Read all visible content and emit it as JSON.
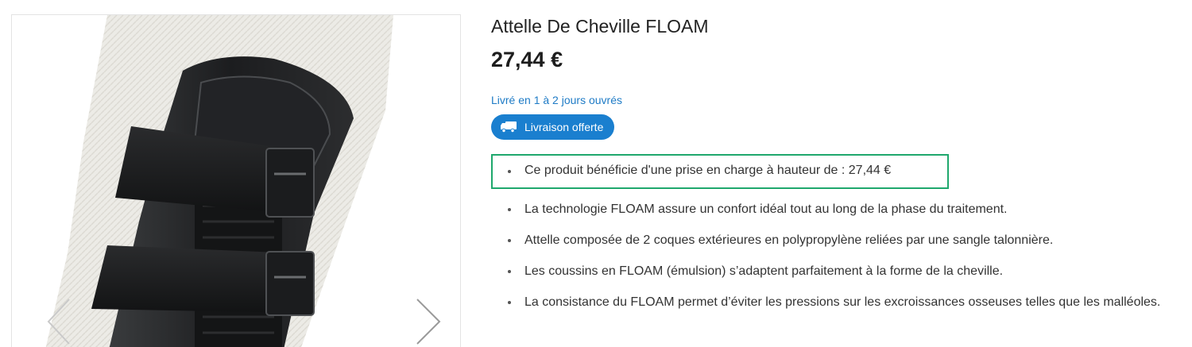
{
  "product": {
    "title": "Attelle De Cheville FLOAM",
    "price": "27,44 €",
    "delivery_time": "Livré en 1 à 2 jours ouvrés",
    "shipping_badge": {
      "icon": "truck-icon",
      "label": "Livraison offerte"
    },
    "features": [
      "Ce produit bénéficie d'une prise en charge à hauteur de : 27,44 €",
      "La technologie FLOAM assure un confort idéal tout au long de la phase du traitement.",
      "Attelle composée de 2 coques extérieures en polypropylène reliées par une sangle talonnière.",
      "Les coussins en FLOAM (émulsion) s’adaptent parfaitement à la forme de la cheville.",
      "La consistance du FLOAM permet d’éviter les pressions sur les excroissances osseuses telles que les malléoles."
    ]
  },
  "gallery": {
    "prev_icon": "chevron-left-icon",
    "next_icon": "chevron-right-icon"
  },
  "colors": {
    "accent": "#1a7fcf",
    "link": "#1e7bc6",
    "highlight_border": "#1fa86d"
  }
}
